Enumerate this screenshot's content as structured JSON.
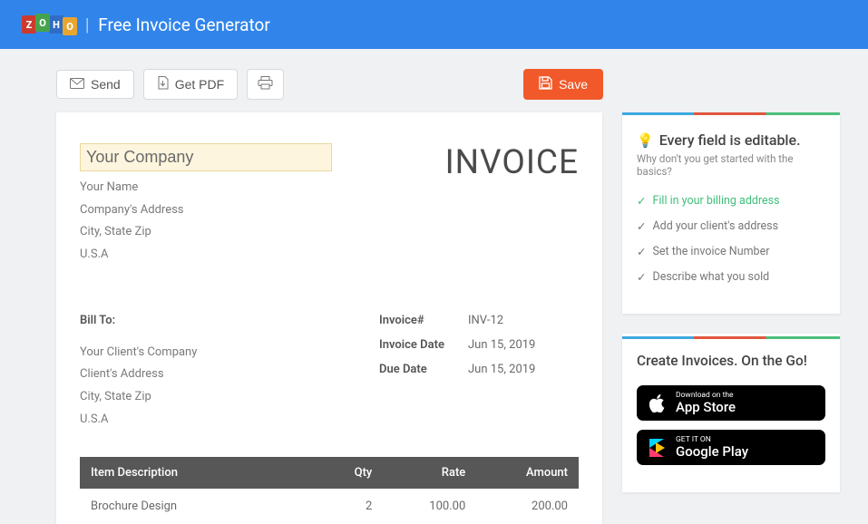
{
  "header": {
    "logo_letters": [
      "Z",
      "O",
      "H",
      "O"
    ],
    "title": "Free Invoice Generator"
  },
  "toolbar": {
    "send": "Send",
    "get_pdf": "Get PDF",
    "save": "Save"
  },
  "invoice": {
    "title": "INVOICE",
    "company": {
      "name_placeholder": "Your Company",
      "your_name": "Your Name",
      "address": "Company's Address",
      "city_line": "City, State Zip",
      "country": "U.S.A"
    },
    "bill_to": {
      "label": "Bill To:",
      "client_company": "Your Client's Company",
      "client_address": "Client's Address",
      "city_line": "City, State Zip",
      "country": "U.S.A"
    },
    "meta": {
      "number_label": "Invoice#",
      "number_value": "INV-12",
      "date_label": "Invoice Date",
      "date_value": "Jun 15, 2019",
      "due_label": "Due Date",
      "due_value": "Jun 15, 2019"
    },
    "items": {
      "headers": {
        "desc": "Item Description",
        "qty": "Qty",
        "rate": "Rate",
        "amount": "Amount"
      },
      "rows": [
        {
          "desc": "Brochure Design",
          "qty": "2",
          "rate": "100.00",
          "amount": "200.00"
        }
      ]
    }
  },
  "tips": {
    "title": "Every field is editable.",
    "subtitle": "Why don't you get started with the basics?",
    "items": [
      {
        "text": "Fill in your billing address",
        "done": true
      },
      {
        "text": "Add your client's address",
        "done": false
      },
      {
        "text": "Set the invoice Number",
        "done": false
      },
      {
        "text": "Describe what you sold",
        "done": false
      }
    ]
  },
  "promo": {
    "title": "Create Invoices. On the Go!",
    "appstore_small": "Download on the",
    "appstore_big": "App Store",
    "play_small": "GET IT ON",
    "play_big": "Google Play"
  }
}
